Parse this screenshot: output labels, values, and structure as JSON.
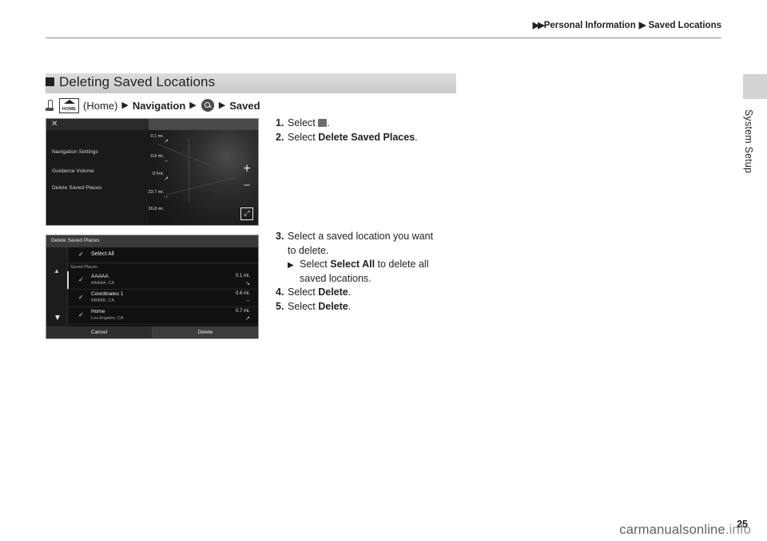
{
  "header": {
    "breadcrumb_arrows": "▶▶",
    "crumb1": "Personal Information",
    "crumb2": "Saved Locations",
    "separator": "▶"
  },
  "side": {
    "label": "System Setup"
  },
  "section": {
    "title": "Deleting Saved Locations"
  },
  "navpath": {
    "home_icon_label": "HOME",
    "home_text": "(Home)",
    "arrow": "▶",
    "navigation": "Navigation",
    "search_icon": "search-icon",
    "saved": "Saved"
  },
  "screenshot1": {
    "close_icon": "✕",
    "menu": [
      "Navigation Settings",
      "Guidance Volume",
      "Delete Saved Places"
    ],
    "distances": [
      "0.1 mi.",
      "0.6 mi.",
      "0 Fnt.",
      "23.7 mi.",
      "16.8 mi."
    ],
    "turn_icons": [
      "↗",
      "→",
      "↗",
      "→"
    ],
    "plus_label": "+",
    "minus_label": "−",
    "expand_label": "⤢"
  },
  "screenshot2": {
    "title": "Delete Saved Places",
    "select_all_label": "Select All",
    "group_label": "Saved Places",
    "check_glyph": "✓",
    "rail_top_icon": "▲",
    "rail_bottom_icon": "▼",
    "rows": [
      {
        "name": "AAAAA",
        "sub": "AAAAA, CA",
        "dist": "0.1 mi.",
        "arrow": "↘"
      },
      {
        "name": "Coordinates 1",
        "sub": "BBBBB, CA",
        "dist": "0.6 mi.",
        "arrow": "→"
      },
      {
        "name": "Home",
        "sub": "Los Angeles, CA",
        "dist": "0.7 mi.",
        "arrow": "↗"
      }
    ],
    "cancel_label": "Cancel",
    "delete_label": "Delete"
  },
  "instructions": {
    "step1_num": "1.",
    "step1_text": "Select",
    "step1_period": ".",
    "step2_num": "2.",
    "step2_text": "Select",
    "step2_bold": "Delete Saved Places",
    "step2_period": ".",
    "step3_num": "3.",
    "step3_line1": "Select a saved location you want",
    "step3_line2": "to delete.",
    "sub_arrow": "▶",
    "sub_text1": "Select",
    "sub_bold": "Select All",
    "sub_text2": "to delete all",
    "sub_line2": "saved locations.",
    "step4_num": "4.",
    "step4_text": "Select",
    "step4_bold": "Delete",
    "step4_period": ".",
    "step5_num": "5.",
    "step5_text": "Select",
    "step5_bold": "Delete",
    "step5_period": "."
  },
  "footer": {
    "page_number": "25",
    "watermark_main": "carmanualsonline",
    "watermark_dim": ".info"
  }
}
